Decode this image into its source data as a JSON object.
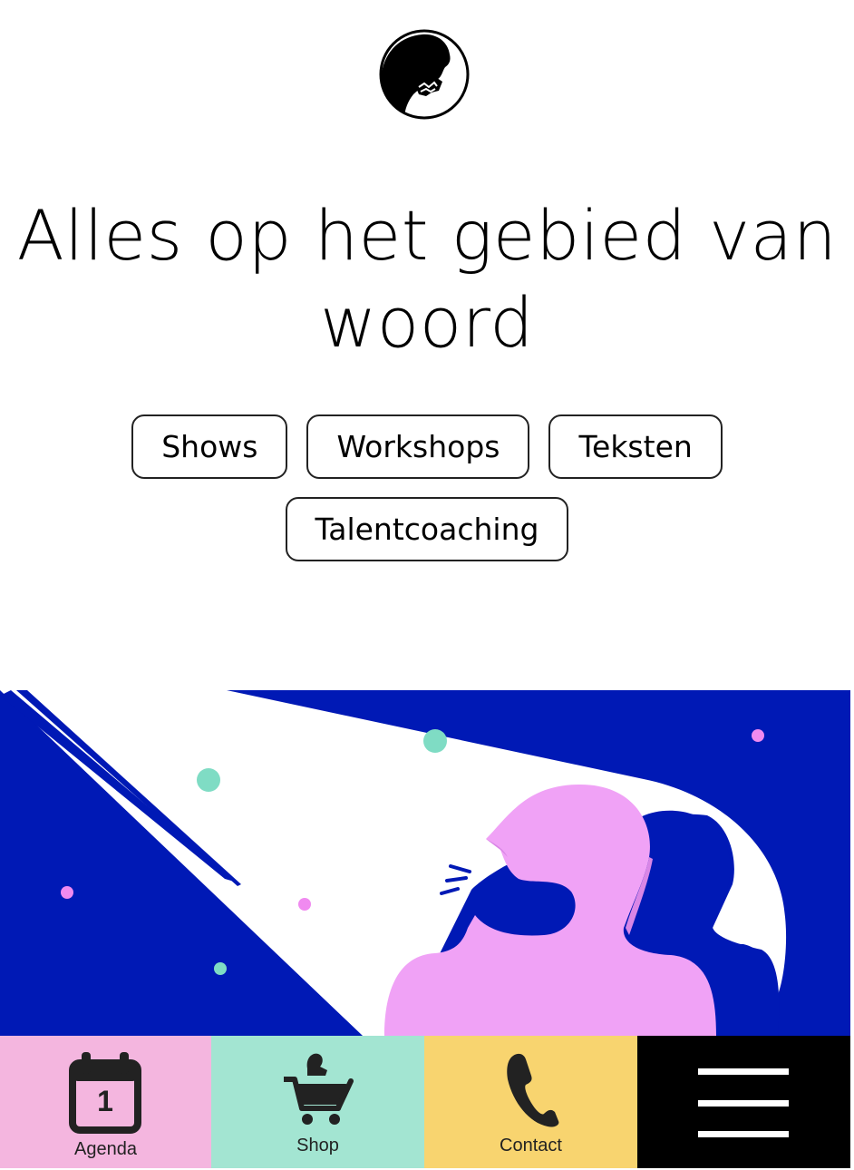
{
  "brand": {
    "logo_icon": "speaking-head-logo-icon"
  },
  "headline": "Alles op het gebied van woord",
  "categories": [
    "Shows",
    "Workshops",
    "Teksten",
    "Talentcoaching"
  ],
  "hero": {
    "illustration": "person-speaking-in-spotlight-illustration",
    "colors": {
      "background": "#0019b5",
      "person": "#f0a2f6",
      "accent_dots": "#7fdcc4",
      "pink_dots": "#f08af0"
    }
  },
  "bottom_nav": {
    "agenda": {
      "label": "Agenda",
      "icon": "calendar-icon",
      "day": "1",
      "color": "#f4b6df"
    },
    "shop": {
      "label": "Shop",
      "icon": "shopping-cart-icon",
      "color": "#a3e5d2"
    },
    "contact": {
      "label": "Contact",
      "icon": "phone-icon",
      "color": "#f8d46f"
    },
    "menu": {
      "icon": "hamburger-menu-icon",
      "color": "#000000"
    }
  }
}
